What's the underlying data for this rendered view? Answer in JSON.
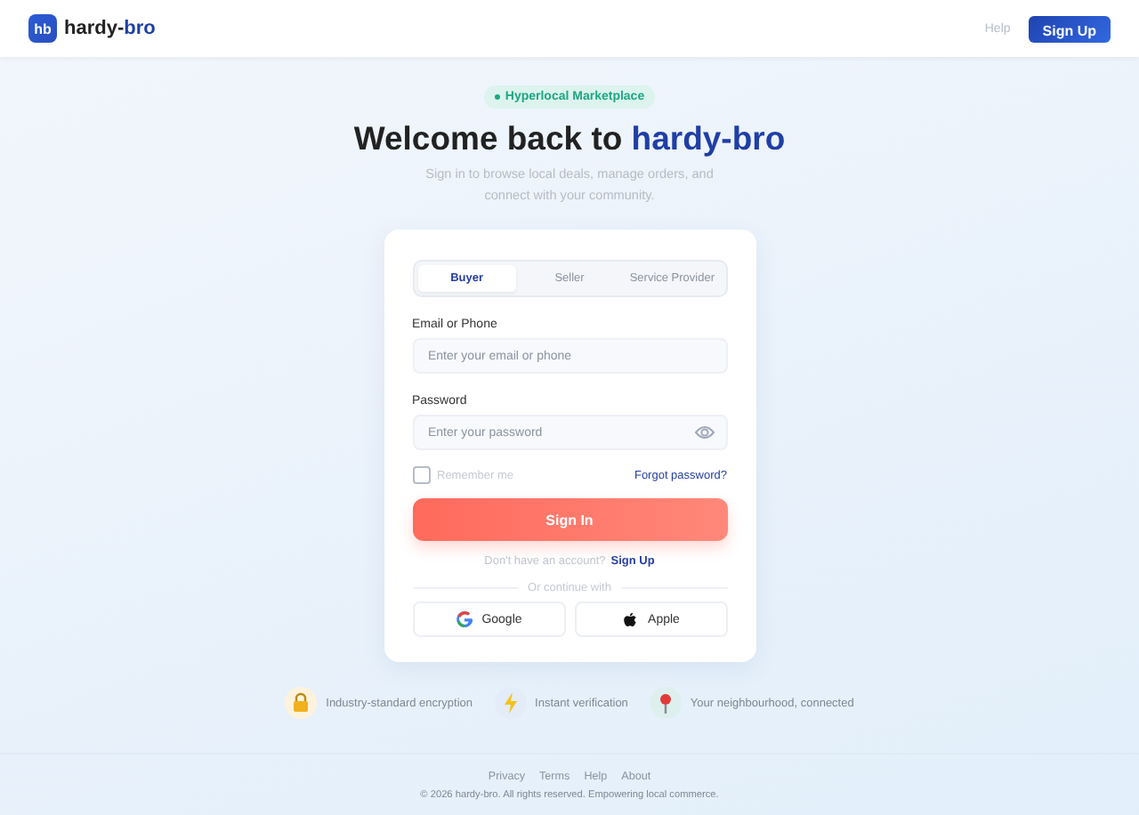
{
  "header": {
    "logo_mark": "hb",
    "brand_lead": "hardy-",
    "brand_accent": "bro",
    "links": [
      "Help"
    ],
    "signup_button": "Sign Up"
  },
  "hero": {
    "badge": "Hyperlocal Marketplace",
    "title_lead": "Welcome back to ",
    "title_accent": "hardy-bro",
    "subtitle": "Sign in to browse local deals, manage orders, and connect with your community."
  },
  "login": {
    "tabs": [
      {
        "label": "Buyer",
        "selected": true
      },
      {
        "label": "Seller",
        "selected": false
      },
      {
        "label": "Service Provider",
        "selected": false
      }
    ],
    "fields": [
      {
        "label": "Email or Phone",
        "placeholder": "Enter your email or phone",
        "kind": "text"
      },
      {
        "label": "Password",
        "placeholder": "Enter your password",
        "kind": "password"
      }
    ],
    "remember": {
      "label": "Remember me",
      "checked": false
    },
    "forgot_link": "Forgot password?",
    "submit_button": "Sign In",
    "signup_prompt": "Don't have an account?",
    "signup_link": "Sign Up",
    "divider": "Or continue with",
    "social_buttons": [
      {
        "label": "Google",
        "kind": "google"
      },
      {
        "label": "Apple",
        "kind": "apple"
      }
    ]
  },
  "features": [
    {
      "label": "Industry-standard encryption",
      "kind": "lock"
    },
    {
      "label": "Instant verification",
      "kind": "bolt"
    },
    {
      "label": "Your neighbourhood, connected",
      "kind": "pin"
    }
  ],
  "footer": {
    "links": [
      "Privacy",
      "Terms",
      "Help",
      "About"
    ],
    "copyright": "© 2026 hardy-bro. All rights reserved. Empowering local commerce."
  }
}
